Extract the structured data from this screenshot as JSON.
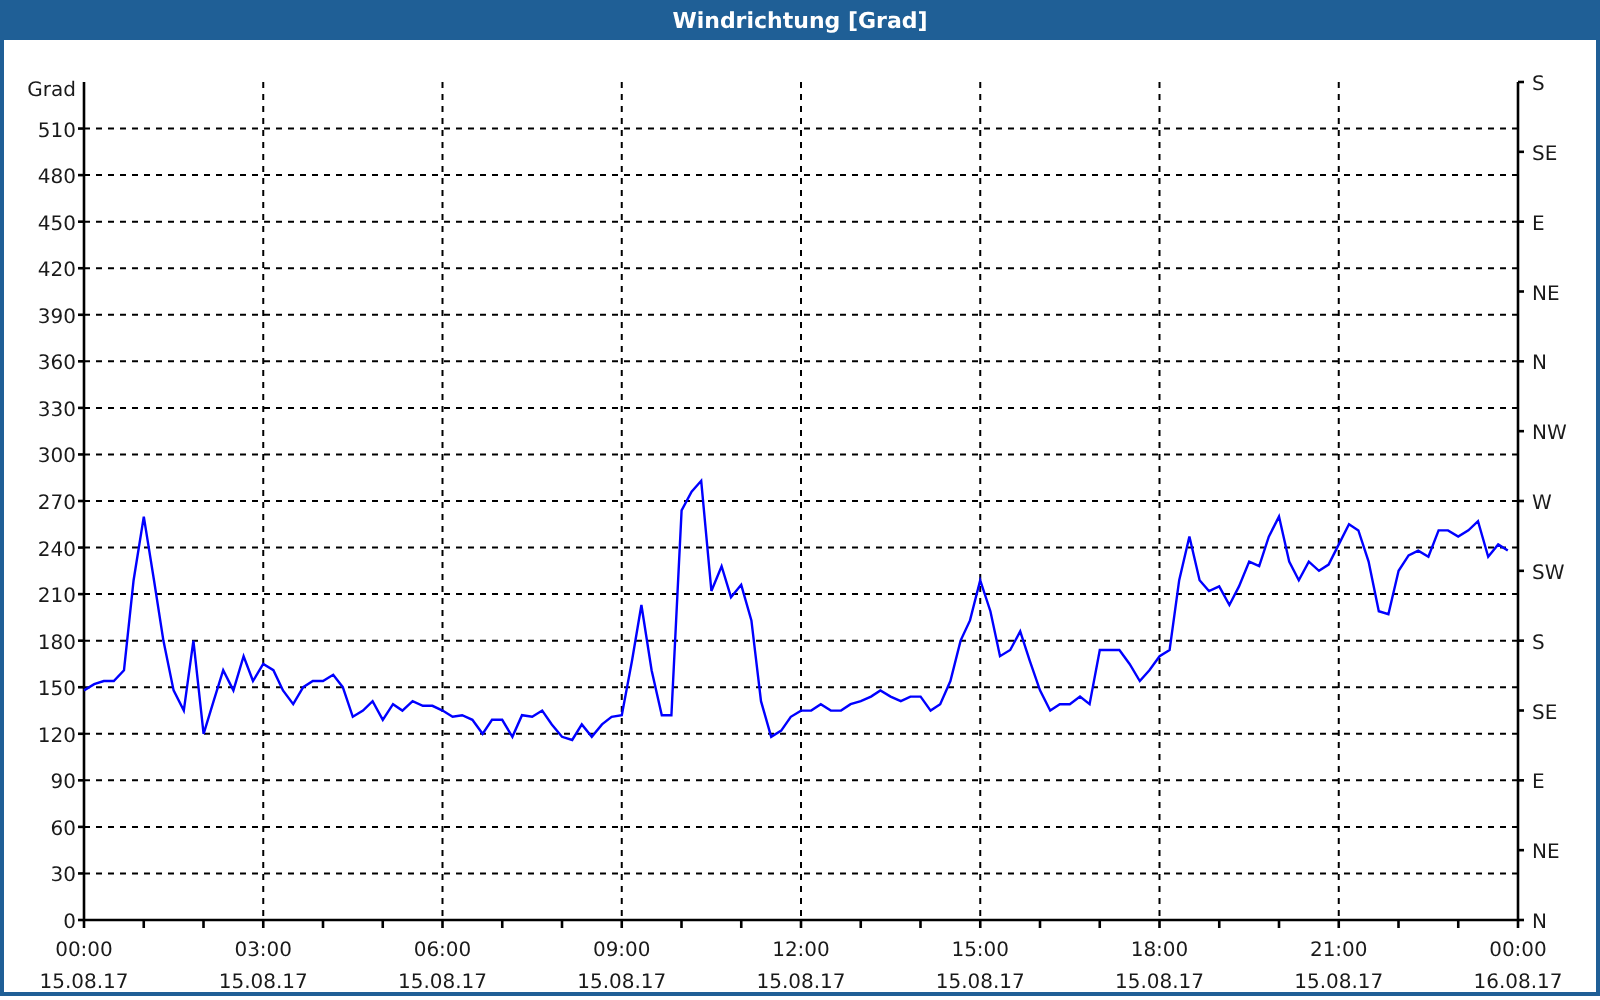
{
  "window": {
    "title": "Windrichtung [Grad]"
  },
  "chart": {
    "chart_data": {
      "type": "line",
      "ylabel": "Grad",
      "x": [
        0,
        0.17,
        0.33,
        0.5,
        0.67,
        0.83,
        1,
        1.17,
        1.33,
        1.5,
        1.67,
        1.83,
        2,
        2.17,
        2.33,
        2.5,
        2.67,
        2.83,
        3,
        3.17,
        3.33,
        3.5,
        3.67,
        3.83,
        4,
        4.17,
        4.33,
        4.5,
        4.67,
        4.83,
        5,
        5.17,
        5.33,
        5.5,
        5.67,
        5.83,
        6,
        6.17,
        6.33,
        6.5,
        6.67,
        6.83,
        7,
        7.17,
        7.33,
        7.5,
        7.67,
        7.83,
        8,
        8.17,
        8.33,
        8.5,
        8.67,
        8.83,
        9,
        9.17,
        9.33,
        9.5,
        9.67,
        9.83,
        10,
        10.17,
        10.33,
        10.5,
        10.67,
        10.83,
        11,
        11.17,
        11.33,
        11.5,
        11.67,
        11.83,
        12,
        12.17,
        12.33,
        12.5,
        12.67,
        12.83,
        13,
        13.17,
        13.33,
        13.5,
        13.67,
        13.83,
        14,
        14.17,
        14.33,
        14.5,
        14.67,
        14.83,
        15,
        15.17,
        15.33,
        15.5,
        15.67,
        15.83,
        16,
        16.17,
        16.33,
        16.5,
        16.67,
        16.83,
        17,
        17.17,
        17.33,
        17.5,
        17.67,
        17.83,
        18,
        18.17,
        18.33,
        18.5,
        18.67,
        18.83,
        19,
        19.17,
        19.33,
        19.5,
        19.67,
        19.83,
        20,
        20.17,
        20.33,
        20.5,
        20.67,
        20.83,
        21,
        21.17,
        21.33,
        21.5,
        21.67,
        21.83,
        22,
        22.17,
        22.33,
        22.5,
        22.67,
        22.83,
        23,
        23.17,
        23.33,
        23.5,
        23.67,
        23.83
      ],
      "series": [
        {
          "color": "#0000ff",
          "values": [
            148,
            152,
            154,
            154,
            161,
            219,
            260,
            219,
            180,
            148,
            135,
            180,
            120,
            141,
            161,
            148,
            170,
            154,
            165,
            161,
            148,
            139,
            150,
            154,
            154,
            158,
            150,
            131,
            135,
            141,
            129,
            139,
            135,
            141,
            138,
            138,
            135,
            131,
            132,
            129,
            120,
            129,
            129,
            118,
            132,
            131,
            135,
            126,
            118,
            116,
            126,
            118,
            126,
            131,
            132,
            167,
            203,
            161,
            132,
            132,
            264,
            276,
            283,
            212,
            228,
            208,
            216,
            193,
            141,
            118,
            122,
            131,
            135,
            135,
            139,
            135,
            135,
            139,
            141,
            144,
            148,
            144,
            141,
            144,
            144,
            135,
            139,
            154,
            180,
            193,
            219,
            199,
            170,
            174,
            186,
            167,
            148,
            135,
            139,
            139,
            144,
            139,
            174,
            174,
            174,
            165,
            154,
            161,
            170,
            174,
            219,
            247,
            219,
            212,
            215,
            203,
            215,
            231,
            228,
            247,
            260,
            231,
            219,
            231,
            225,
            229,
            242,
            255,
            251,
            231,
            199,
            197,
            225,
            235,
            238,
            234,
            251,
            251,
            247,
            251,
            257,
            234,
            242,
            238
          ]
        }
      ],
      "xlim": [
        0,
        24
      ],
      "ylim": [
        0,
        540
      ],
      "xticks": [
        {
          "value": 0,
          "label": "00:00"
        },
        {
          "value": 3,
          "label": "03:00"
        },
        {
          "value": 6,
          "label": "06:00"
        },
        {
          "value": 9,
          "label": "09:00"
        },
        {
          "value": 12,
          "label": "12:00"
        },
        {
          "value": 15,
          "label": "15:00"
        },
        {
          "value": 18,
          "label": "18:00"
        },
        {
          "value": 21,
          "label": "21:00"
        },
        {
          "value": 24,
          "label": "00:00"
        }
      ],
      "yticks": [
        0,
        30,
        60,
        90,
        120,
        150,
        180,
        210,
        240,
        270,
        300,
        330,
        360,
        390,
        420,
        450,
        480,
        510
      ],
      "grid": true
    },
    "compass_labels": [
      "S",
      "SE",
      "E",
      "NE",
      "N",
      "NW",
      "W",
      "SW",
      "S",
      "SE",
      "E",
      "NE",
      "N"
    ],
    "xtick_dates": [
      "15.08.17",
      "15.08.17",
      "15.08.17",
      "15.08.17",
      "15.08.17",
      "15.08.17",
      "15.08.17",
      "15.08.17",
      "16.08.17"
    ]
  }
}
